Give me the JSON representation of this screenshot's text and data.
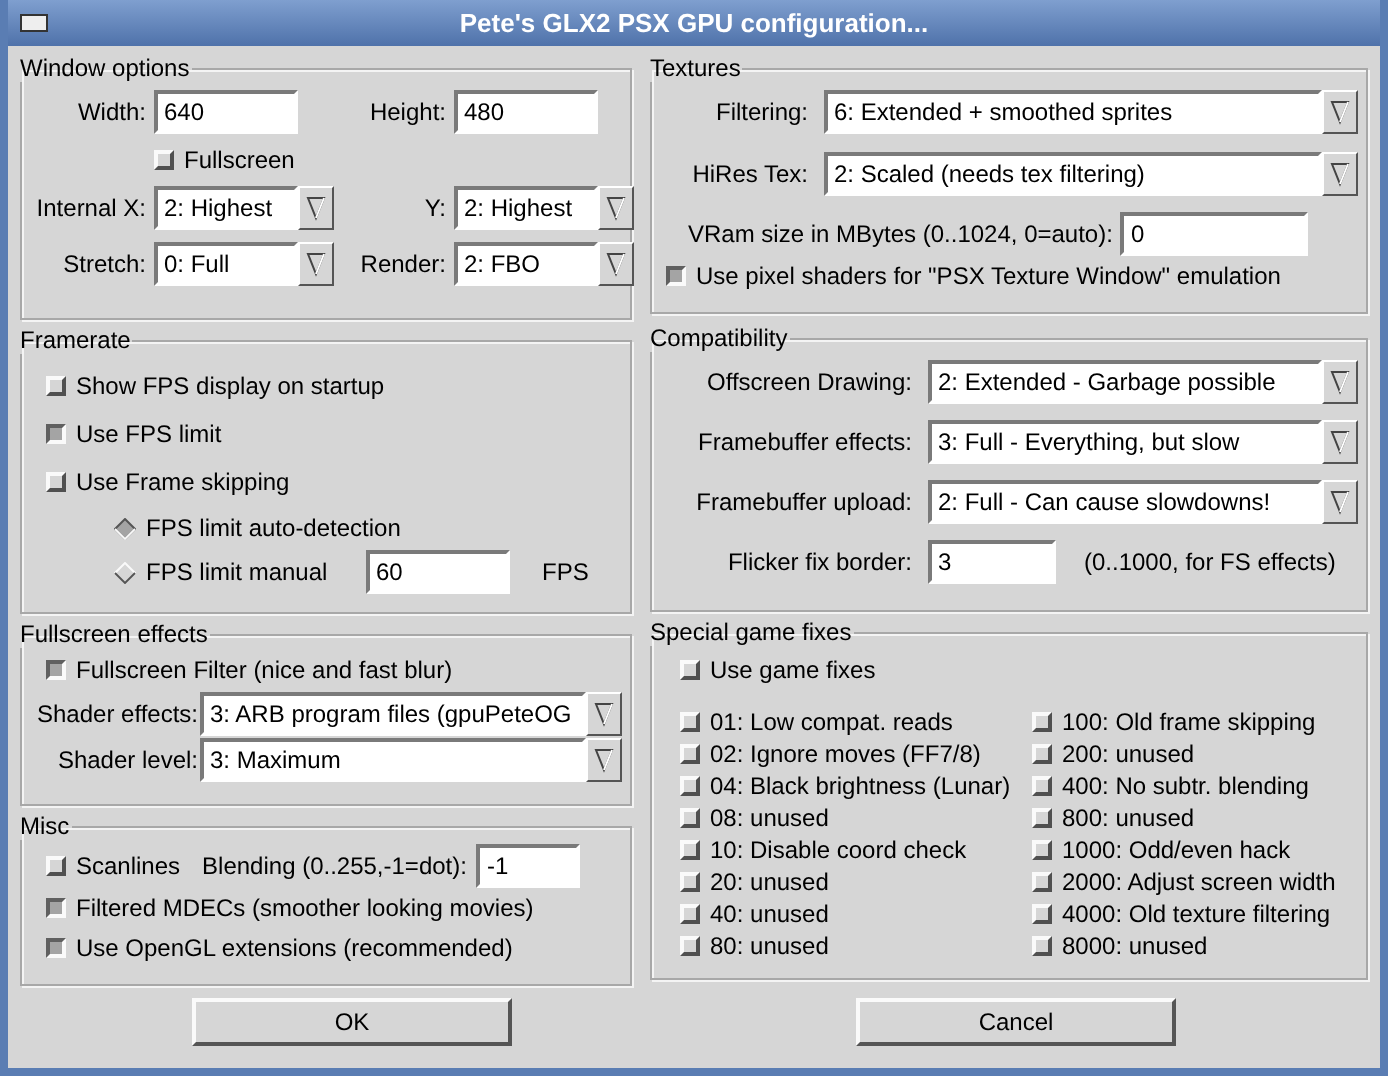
{
  "window": {
    "title": "Pete's GLX2 PSX GPU configuration..."
  },
  "window_options": {
    "title": "Window options",
    "width": {
      "label": "Width:",
      "value": "640"
    },
    "height": {
      "label": "Height:",
      "value": "480"
    },
    "fullscreen": {
      "label": "Fullscreen",
      "checked": false
    },
    "internal_x": {
      "label": "Internal X:",
      "value": "2: Highest"
    },
    "internal_y": {
      "label": "Y:",
      "value": "2: Highest"
    },
    "stretch": {
      "label": "Stretch:",
      "value": "0: Full"
    },
    "render": {
      "label": "Render:",
      "value": "2: FBO"
    }
  },
  "framerate": {
    "title": "Framerate",
    "checkboxes": [
      {
        "label": "Show FPS display on startup",
        "checked": false
      },
      {
        "label": "Use FPS limit",
        "checked": true
      },
      {
        "label": "Use Frame skipping",
        "checked": false
      }
    ],
    "radios": [
      {
        "label": "FPS limit auto-detection",
        "selected": true
      },
      {
        "label": "FPS limit manual",
        "selected": false
      }
    ],
    "fps_value": "60",
    "fps_unit": "FPS"
  },
  "fullscreen_effects": {
    "title": "Fullscreen effects",
    "filter": {
      "label": "Fullscreen Filter (nice and fast blur)",
      "checked": true
    },
    "shader_effects": {
      "label": "Shader effects:",
      "value": "3: ARB program files (gpuPeteOG"
    },
    "shader_level": {
      "label": "Shader level:",
      "value": "3: Maximum"
    }
  },
  "misc": {
    "title": "Misc",
    "scanlines": {
      "label": "Scanlines",
      "checked": false
    },
    "blending": {
      "label": "Blending (0..255,-1=dot):",
      "value": "-1"
    },
    "checkboxes": [
      {
        "label": "Filtered MDECs (smoother looking movies)",
        "checked": true
      },
      {
        "label": "Use OpenGL extensions (recommended)",
        "checked": true
      }
    ]
  },
  "textures": {
    "title": "Textures",
    "filtering": {
      "label": "Filtering:",
      "value": "6: Extended + smoothed sprites"
    },
    "hires": {
      "label": "HiRes Tex:",
      "value": "2: Scaled (needs tex filtering)"
    },
    "vram": {
      "label": "VRam size in MBytes (0..1024, 0=auto):",
      "value": "0"
    },
    "pixel_shaders": {
      "label": "Use pixel shaders for \"PSX Texture Window\" emulation",
      "checked": true
    }
  },
  "compatibility": {
    "title": "Compatibility",
    "dropdowns": [
      {
        "label": "Offscreen Drawing:",
        "value": "2: Extended - Garbage possible"
      },
      {
        "label": "Framebuffer effects:",
        "value": "3: Full - Everything, but slow"
      },
      {
        "label": "Framebuffer upload:",
        "value": "2: Full - Can cause slowdowns!"
      }
    ],
    "flicker": {
      "label": "Flicker fix border:",
      "value": "3",
      "note": "(0..1000, for FS effects)"
    }
  },
  "game_fixes": {
    "title": "Special game fixes",
    "use": {
      "label": "Use game fixes",
      "checked": false
    },
    "fixes": [
      {
        "label": "01: Low compat. reads",
        "checked": false
      },
      {
        "label": "02: Ignore moves (FF7/8)",
        "checked": false
      },
      {
        "label": "04: Black brightness (Lunar)",
        "checked": false
      },
      {
        "label": "08: unused",
        "checked": false
      },
      {
        "label": "10: Disable coord check",
        "checked": false
      },
      {
        "label": "20: unused",
        "checked": false
      },
      {
        "label": "40: unused",
        "checked": false
      },
      {
        "label": "80: unused",
        "checked": false
      },
      {
        "label": "100: Old frame skipping",
        "checked": false
      },
      {
        "label": "200: unused",
        "checked": false
      },
      {
        "label": "400: No subtr. blending",
        "checked": false
      },
      {
        "label": "800: unused",
        "checked": false
      },
      {
        "label": "1000: Odd/even hack",
        "checked": false
      },
      {
        "label": "2000: Adjust screen width",
        "checked": false
      },
      {
        "label": "4000: Old texture filtering",
        "checked": false
      },
      {
        "label": "8000: unused",
        "checked": false
      }
    ]
  },
  "buttons": [
    "OK",
    "Cancel"
  ]
}
